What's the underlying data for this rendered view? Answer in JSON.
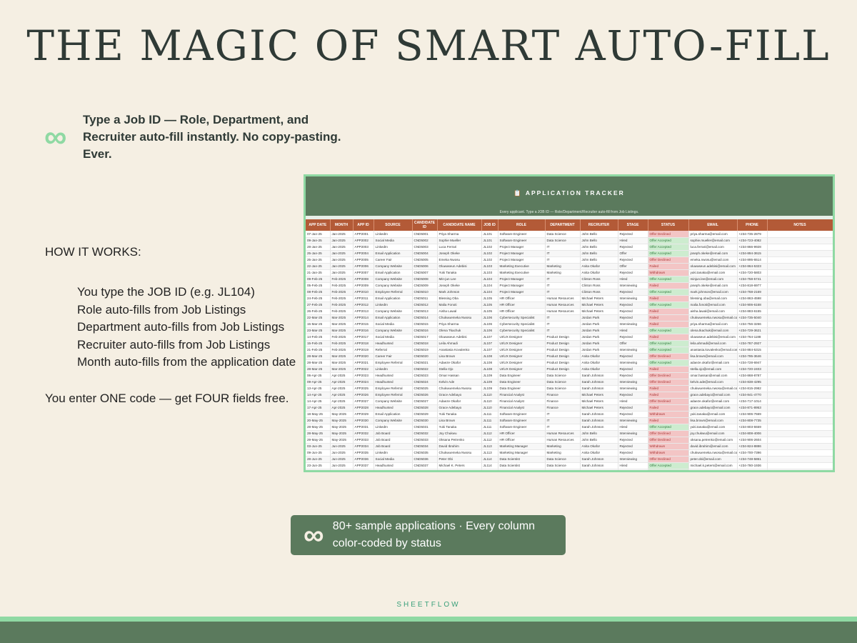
{
  "title": "THE MAGIC OF SMART AUTO-FILL",
  "intro": {
    "icon": "infinity-icon",
    "text": "Type a Job ID — Role, Department, and Recruiter auto-fill instantly. No copy-pasting. Ever."
  },
  "how": {
    "heading": "HOW IT WORKS:",
    "steps": [
      "You type the JOB ID (e.g. JL104)",
      "Role auto-fills from Job Listings",
      "Department auto-fills from Job Listings",
      "Recruiter auto-fills from Job Listings",
      "Month auto-fills from the application date"
    ],
    "tagline": "You enter ONE code — get FOUR fields free."
  },
  "sheet": {
    "title": "📋 APPLICATION TRACKER",
    "subtitle": "Every applicant. Type a JOB ID — Role/Department/Recruiter auto-fill from Job Listings.",
    "headers": [
      "APP DATE",
      "MONTH",
      "APP ID",
      "SOURCE",
      "CANDIDATE ID",
      "CANDIDATE NAME",
      "JOB ID",
      "ROLE",
      "DEPARTMENT",
      "RECRUITER",
      "STAGE",
      "STATUS",
      "EMAIL",
      "PHONE",
      "NOTES"
    ],
    "rows": [
      [
        "07-Jan-25",
        "Jan-2025",
        "APP2001",
        "LinkedIn",
        "CND5001",
        "Priya Sharma",
        "JL101",
        "Software Engineer",
        "Data Science",
        "John Bello",
        "Rejected",
        "Offer Declined",
        "priya.sharma@email.com",
        "+234-735-2879",
        ""
      ],
      [
        "09-Jan-25",
        "Jan-2025",
        "APP2002",
        "Social Media",
        "CND5002",
        "Sophie Mueller",
        "JL101",
        "Software Engineer",
        "Data Science",
        "John Bello",
        "Hired",
        "Offer Accepted",
        "sophie.mueller@email.com",
        "+234-723-4082",
        ""
      ],
      [
        "28-Jan-25",
        "Jan-2025",
        "APP2003",
        "LinkedIn",
        "CND5003",
        "Luca Ferrari",
        "JL102",
        "Project Manager",
        "IT",
        "John Bello",
        "Rejected",
        "Offer Accepted",
        "luca.ferrari@email.com",
        "+234-866-9928",
        ""
      ],
      [
        "25-Jan-25",
        "Jan-2025",
        "APP2004",
        "Email Application",
        "CND5004",
        "Joseph Okeke",
        "JL102",
        "Project Manager",
        "IT",
        "John Bello",
        "Offer",
        "Offer Accepted",
        "joseph.okeke@email.com",
        "+234-894-3615",
        ""
      ],
      [
        "25-Jan-25",
        "Jan-2025",
        "APP2005",
        "Career Fair",
        "CND5005",
        "Emeka Nwosu",
        "JL102",
        "Project Manager",
        "IT",
        "John Bello",
        "Rejected",
        "Offer Declined",
        "emeka.nwosu@email.com",
        "+234-895-6514",
        ""
      ],
      [
        "22-Jan-25",
        "Jan-2025",
        "APP2006",
        "Company Website",
        "CND5006",
        "Oluwaseun Adebisi",
        "JL103",
        "Marketing Executive",
        "Marketing",
        "Anita Okafor",
        "Offer",
        "Failed",
        "oluwaseun.adebisi@email.com",
        "+234-864-5323",
        ""
      ],
      [
        "21-Jan-25",
        "Jan-2025",
        "APP2007",
        "Email Application",
        "CND5007",
        "Yuki Tanaka",
        "JL103",
        "Marketing Executive",
        "Marketing",
        "Anita Okafor",
        "Rejected",
        "Withdrawn",
        "yuki.tanaka@email.com",
        "+234-720-5803",
        ""
      ],
      [
        "09-Feb-25",
        "Feb-2025",
        "APP2008",
        "Company Website",
        "CND5008",
        "Min-jun Lee",
        "JL104",
        "Project Manager",
        "IT",
        "Clinton Ross",
        "Hired",
        "Offer Accepted",
        "minjun.lee@email.com",
        "+234-758-5741",
        ""
      ],
      [
        "05-Feb-25",
        "Feb-2025",
        "APP2009",
        "Company Website",
        "CND5009",
        "Joseph Okeke",
        "JL104",
        "Project Manager",
        "IT",
        "Clinton Ross",
        "Interviewing",
        "Failed",
        "joseph.okeke@email.com",
        "+234-818-6977",
        ""
      ],
      [
        "08-Feb-25",
        "Feb-2025",
        "APP2010",
        "Employee Referral",
        "CND5010",
        "Mark Johnson",
        "JL104",
        "Project Manager",
        "IT",
        "Clinton Ross",
        "Rejected",
        "Offer Accepted",
        "mark.johnson@email.com",
        "+234-768-2169",
        ""
      ],
      [
        "24-Feb-25",
        "Feb-2025",
        "APP2011",
        "Email Application",
        "CND5011",
        "Blessing Oba",
        "JL105",
        "HR Officer",
        "Human Resources",
        "Michael Peters",
        "Interviewing",
        "Failed",
        "blessing.oba@email.com",
        "+234-863-4598",
        ""
      ],
      [
        "27-Feb-25",
        "Feb-2025",
        "APP2012",
        "LinkedIn",
        "CND5012",
        "Malia Fonoti",
        "JL105",
        "HR Officer",
        "Human Resources",
        "Michael Peters",
        "Rejected",
        "Offer Accepted",
        "malia.fonoti@email.com",
        "+234-906-6168",
        ""
      ],
      [
        "26-Feb-25",
        "Feb-2025",
        "APP2013",
        "Company Website",
        "CND5013",
        "Aisha Lawal",
        "JL105",
        "HR Officer",
        "Human Resources",
        "Michael Peters",
        "Rejected",
        "Failed",
        "aisha.lawal@email.com",
        "+234-883-6155",
        ""
      ],
      [
        "22-Mar-25",
        "Mar-2025",
        "APP2014",
        "Email Application",
        "CND5014",
        "Chukwuemeka Nwosu",
        "JL106",
        "Cybersecurity Specialist",
        "IT",
        "Jordan Park",
        "Rejected",
        "Failed",
        "chukwuemeka.nwosu@email.com",
        "+234-735-5040",
        ""
      ],
      [
        "15-Mar-25",
        "Mar-2025",
        "APP2015",
        "Social Media",
        "CND5015",
        "Priya Sharma",
        "JL106",
        "Cybersecurity Specialist",
        "IT",
        "Jordan Park",
        "Interviewing",
        "Failed",
        "priya.sharma@email.com",
        "+234-756-3266",
        ""
      ],
      [
        "23-Mar-25",
        "Mar-2025",
        "APP2016",
        "Company Website",
        "CND5016",
        "Olena Tkachuk",
        "JL106",
        "Cybersecurity Specialist",
        "IT",
        "Jordan Park",
        "Hired",
        "Offer Accepted",
        "olena.tkachuk@email.com",
        "+234-729-3621",
        ""
      ],
      [
        "14-Feb-25",
        "Feb-2025",
        "APP2017",
        "Social Media",
        "CND5017",
        "Oluwaseun Adebisi",
        "JL107",
        "UI/UX Designer",
        "Product Design",
        "Jordan Park",
        "Rejected",
        "Failed",
        "oluwaseun.adebisi@email.com",
        "+234-764-1188",
        ""
      ],
      [
        "15-Feb-25",
        "Feb-2025",
        "APP2018",
        "Headhunted",
        "CND5018",
        "Leila Ahmadi",
        "JL107",
        "UI/UX Designer",
        "Product Design",
        "Jordan Park",
        "Offer",
        "Offer Accepted",
        "leila.ahmadi@email.com",
        "+234-787-2927",
        ""
      ],
      [
        "21-Feb-25",
        "Feb-2025",
        "APP2019",
        "Referral",
        "CND5019",
        "Anastasia Kovalenko",
        "JL107",
        "UI/UX Designer",
        "Product Design",
        "Jordan Park",
        "Interviewing",
        "Offer Accepted",
        "anastasia.kovalenko@email.com",
        "+234-884-5315",
        ""
      ],
      [
        "28-Mar-25",
        "Mar-2025",
        "APP2020",
        "Career Fair",
        "CND5020",
        "Lisa Brown",
        "JL108",
        "UI/UX Designer",
        "Product Design",
        "Anita Okafor",
        "Rejected",
        "Offer Declined",
        "lisa.brown@email.com",
        "+234-795-3646",
        ""
      ],
      [
        "28-Mar-25",
        "Mar-2025",
        "APP2021",
        "Employee Referral",
        "CND5021",
        "Adaeze Okafor",
        "JL108",
        "UI/UX Designer",
        "Product Design",
        "Anita Okafor",
        "Interviewing",
        "Offer Accepted",
        "adaeze.okafor@email.com",
        "+234-728-6947",
        ""
      ],
      [
        "28-Mar-25",
        "Mar-2025",
        "APP2022",
        "LinkedIn",
        "CND5022",
        "Stella Ojo",
        "JL108",
        "UI/UX Designer",
        "Product Design",
        "Anita Okafor",
        "Rejected",
        "Failed",
        "stella.ojo@email.com",
        "+234-720-2403",
        ""
      ],
      [
        "06-Apr-25",
        "Apr-2025",
        "APP2023",
        "Headhunted",
        "CND5023",
        "Omar Hassan",
        "JL109",
        "Data Engineer",
        "Data Science",
        "Sarah Johnson",
        "Rejected",
        "Offer Declined",
        "omar.hassan@email.com",
        "+234-868-8787",
        ""
      ],
      [
        "09-Apr-25",
        "Apr-2025",
        "APP2024",
        "Headhunted",
        "CND5024",
        "Kelvin Ade",
        "JL109",
        "Data Engineer",
        "Data Science",
        "Sarah Johnson",
        "Interviewing",
        "Offer Declined",
        "kelvin.ade@email.com",
        "+234-838-4295",
        ""
      ],
      [
        "13-Apr-25",
        "Apr-2025",
        "APP2025",
        "Employee Referral",
        "CND5025",
        "Chukwuemeka Nwosu",
        "JL109",
        "Data Engineer",
        "Data Science",
        "Sarah Johnson",
        "Interviewing",
        "Failed",
        "chukwuemeka.nwosu@email.com",
        "+234-815-2982",
        ""
      ],
      [
        "14-Apr-25",
        "Apr-2025",
        "APP2026",
        "Employee Referral",
        "CND5026",
        "Grace Adebayo",
        "JL110",
        "Financial Analyst",
        "Finance",
        "Michael Peters",
        "Rejected",
        "Failed",
        "grace.adebayo@email.com",
        "+234-841-4770",
        ""
      ],
      [
        "14-Apr-25",
        "Apr-2025",
        "APP2027",
        "Company Website",
        "CND5027",
        "Adaeze Okafor",
        "JL110",
        "Financial Analyst",
        "Finance",
        "Michael Peters",
        "Hired",
        "Offer Declined",
        "adaeze.okafor@email.com",
        "+234-717-1014",
        ""
      ],
      [
        "17-Apr-25",
        "Apr-2025",
        "APP2028",
        "Headhunted",
        "CND5028",
        "Grace Adebayo",
        "JL110",
        "Financial Analyst",
        "Finance",
        "Michael Peters",
        "Rejected",
        "Failed",
        "grace.adebayo@email.com",
        "+234-871-8953",
        ""
      ],
      [
        "18-May-25",
        "May-2025",
        "APP2029",
        "Email Application",
        "CND5029",
        "Yuki Tanaka",
        "JL111",
        "Software Engineer",
        "IT",
        "Sarah Johnson",
        "Rejected",
        "Withdrawn",
        "yuki.tanaka@email.com",
        "+234-906-7669",
        ""
      ],
      [
        "20-May-25",
        "May-2025",
        "APP2030",
        "Company Website",
        "CND5030",
        "Lisa Brown",
        "JL111",
        "Software Engineer",
        "IT",
        "Sarah Johnson",
        "Interviewing",
        "Failed",
        "lisa.brown@email.com",
        "+234-808-7735",
        ""
      ],
      [
        "28-May-25",
        "May-2025",
        "APP2031",
        "LinkedIn",
        "CND5031",
        "Yuki Tanaka",
        "JL111",
        "Software Engineer",
        "IT",
        "Sarah Johnson",
        "Hired",
        "Offer Accepted",
        "yuki.tanaka@email.com",
        "+234-803-5559",
        ""
      ],
      [
        "28-May-25",
        "May-2025",
        "APP2032",
        "Job Board",
        "CND5032",
        "Joy Chukwu",
        "JL112",
        "HR Officer",
        "Human Resources",
        "John Bello",
        "Interviewing",
        "Offer Declined",
        "joy.chukwu@email.com",
        "+234-808-4006",
        ""
      ],
      [
        "29-May-25",
        "May-2025",
        "APP2033",
        "Job Board",
        "CND5033",
        "Oksana Petrenko",
        "JL112",
        "HR Officer",
        "Human Resources",
        "John Bello",
        "Rejected",
        "Offer Declined",
        "oksana.petrenko@email.com",
        "+234-906-2604",
        ""
      ],
      [
        "03-Jun-25",
        "Jun-2025",
        "APP2034",
        "Job Board",
        "CND5034",
        "David Ibrahim",
        "JL113",
        "Marketing Manager",
        "Marketing",
        "Anita Okafor",
        "Rejected",
        "Withdrawn",
        "david.ibrahim@email.com",
        "+234-824-8886",
        ""
      ],
      [
        "09-Jun-25",
        "Jun-2025",
        "APP2035",
        "LinkedIn",
        "CND5035",
        "Chukwuemeka Nwosu",
        "JL113",
        "Marketing Manager",
        "Marketing",
        "Anita Okafor",
        "Rejected",
        "Withdrawn",
        "chukwuemeka.nwosu@email.com",
        "+234-700-7396",
        ""
      ],
      [
        "28-Jun-25",
        "Jun-2025",
        "APP2036",
        "Social Media",
        "CND5036",
        "Peter Obi",
        "JL114",
        "Data Scientist",
        "Data Science",
        "Sarah Johnson",
        "Interviewing",
        "Offer Declined",
        "peter.obi@email.com",
        "+234-748-5861",
        ""
      ],
      [
        "23-Jun-25",
        "Jun-2025",
        "APP2037",
        "Headhunted",
        "CND5037",
        "Michael K. Peters",
        "JL114",
        "Data Scientist",
        "Data Science",
        "Sarah Johnson",
        "Hired",
        "Offer Accepted",
        "michael.k.peters@email.com",
        "+234-780-1936",
        ""
      ],
      [
        "18-Jun-25",
        "Jun-2025",
        "APP2038",
        "Email Application",
        "CND5038",
        "Sophie Mueller",
        "JL114",
        "Data Scientist",
        "Data Science",
        "Sarah Johnson",
        "Rejected",
        "Offer Accepted",
        "sophie.mueller@email.com",
        "+234-830-2312",
        ""
      ]
    ]
  },
  "badge": {
    "icon": "infinity-icon",
    "text": "80+ sample applications · Every column color-coded by status"
  },
  "brand": "SHEETFLOW",
  "colors": {
    "background": "#f5efe3",
    "accent": "#8fd9a3",
    "dark_green": "#5b7a5d",
    "header_rust": "#b35a37",
    "status_red": "#f3c5c5",
    "status_green": "#cdeccf"
  }
}
